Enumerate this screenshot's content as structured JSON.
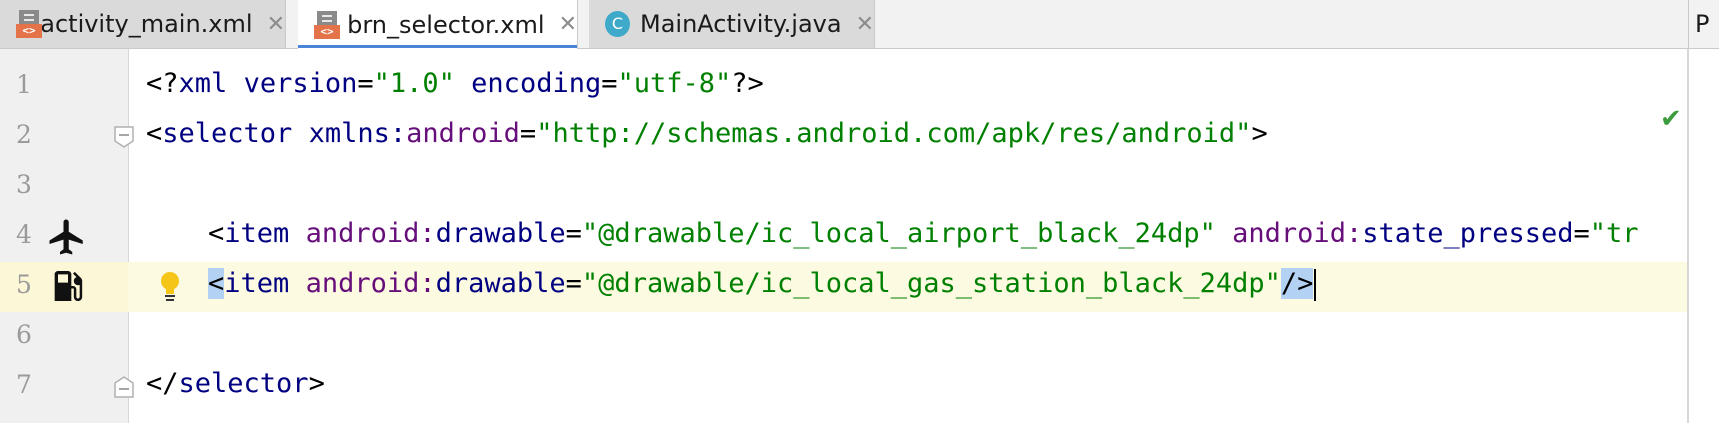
{
  "tabs": [
    {
      "label": "activity_main.xml",
      "icon": "xml-file-icon",
      "active": false
    },
    {
      "label": "brn_selector.xml",
      "icon": "xml-file-icon",
      "active": true
    },
    {
      "label": "MainActivity.java",
      "icon": "java-class-icon",
      "active": false
    }
  ],
  "tab_close_glyph": "✕",
  "xml_icon_text": "<>",
  "class_icon_text": "C",
  "right_tab_label": "P",
  "editor": {
    "line_numbers": [
      "1",
      "2",
      "3",
      "4",
      "5",
      "6",
      "7"
    ],
    "current_line": 5,
    "lines": {
      "l1": {
        "open": "<?",
        "tag": "xml",
        "sp1": " ",
        "a1": "version",
        "eq1": "=",
        "v1": "\"1.0\"",
        "sp2": " ",
        "a2": "encoding",
        "eq2": "=",
        "v2": "\"utf-8\"",
        "close": "?>"
      },
      "l2": {
        "open": "<",
        "tag": "selector",
        "sp1": " ",
        "a1": "xmlns:",
        "a1b": "android",
        "eq1": "=",
        "v1": "\"http://schemas.android.com/apk/res/android\"",
        "close": ">"
      },
      "l4": {
        "open": "<",
        "tag": "item",
        "sp1": " ",
        "a1ns": "android:",
        "a1": "drawable",
        "eq1": "=",
        "v1": "\"@drawable/ic_local_airport_black_24dp\"",
        "sp2": " ",
        "a2ns": "android:",
        "a2": "state_pressed",
        "eq2": "=",
        "v2": "\"tr"
      },
      "l5": {
        "open": "<",
        "tag": "item",
        "sp1": " ",
        "a1ns": "android:",
        "a1": "drawable",
        "eq1": "=",
        "v1": "\"@drawable/ic_local_gas_station_black_24dp\"",
        "close": "/>"
      },
      "l7": {
        "open": "</",
        "tag": "selector",
        "close": ">"
      }
    }
  },
  "gutter_icons": {
    "line4": "airplane-icon",
    "line5": "gas-station-icon",
    "line5_intention": "lightbulb-icon"
  },
  "status": {
    "analysis_ok_glyph": "✔"
  },
  "colors": {
    "tag": "#000080",
    "attribute": "#660e7a",
    "value": "#008000",
    "current_line": "#fdfae2",
    "selection": "#b3d2f3"
  }
}
